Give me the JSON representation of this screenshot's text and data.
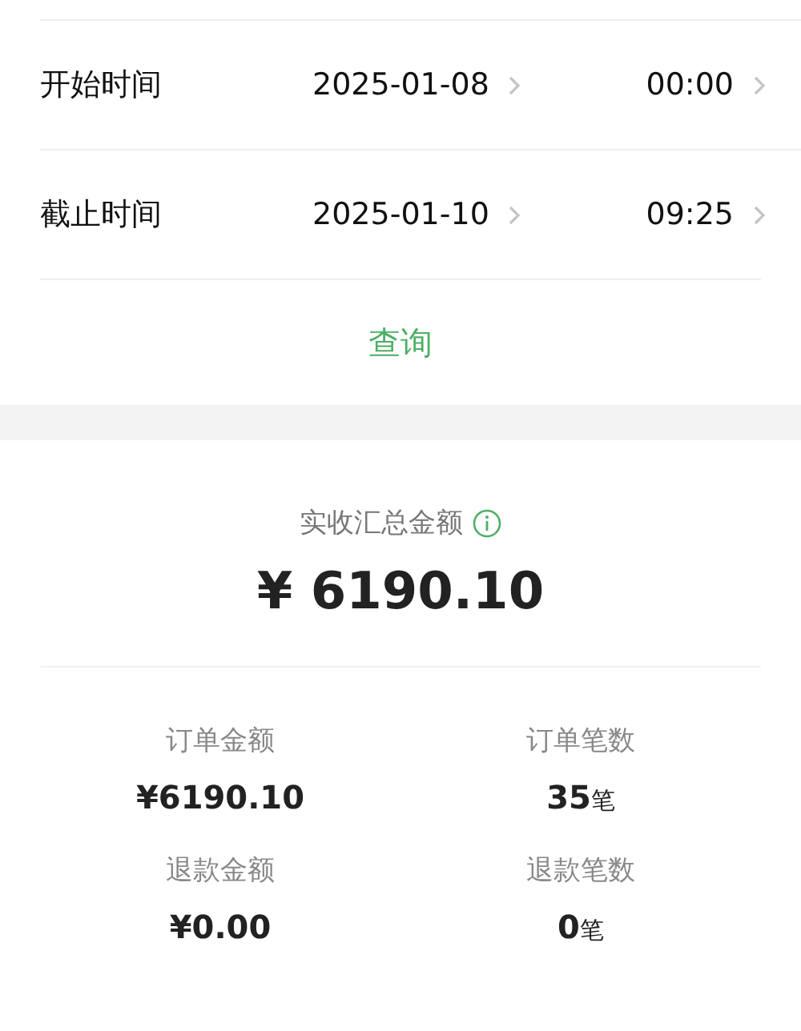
{
  "time_rows": [
    {
      "label": "开始时间",
      "date": "2025-01-08",
      "time": "00:00"
    },
    {
      "label": "截止时间",
      "date": "2025-01-10",
      "time": "09:25"
    }
  ],
  "query_button": "查询",
  "summary": {
    "title": "实收汇总金额",
    "total": "¥ 6190.10"
  },
  "stats": [
    {
      "label": "订单金额",
      "value": "¥6190.10"
    },
    {
      "label": "订单笔数",
      "value": "35",
      "unit": "笔"
    },
    {
      "label": "退款金额",
      "value": "¥0.00"
    },
    {
      "label": "退款笔数",
      "value": "0",
      "unit": "笔"
    }
  ]
}
